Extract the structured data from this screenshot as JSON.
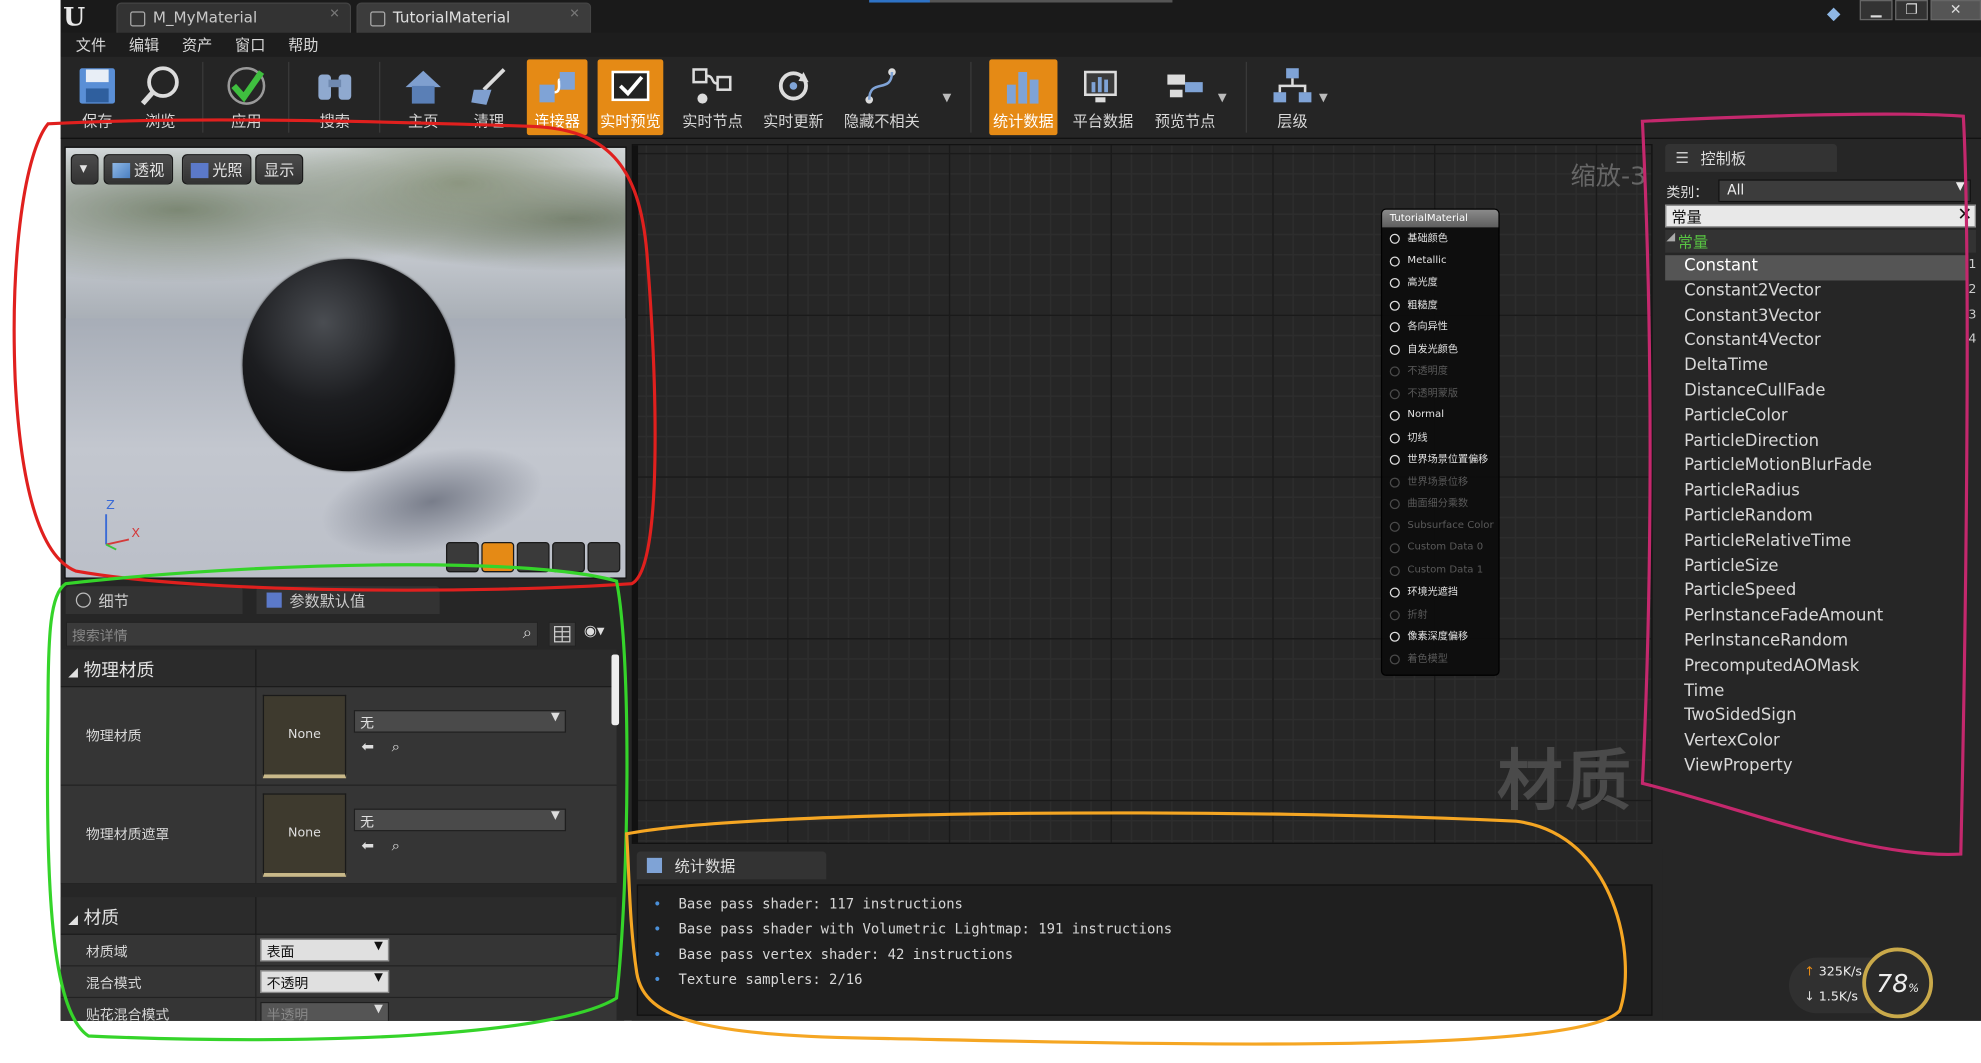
{
  "titlebar": {
    "tabs": [
      {
        "label": "M_MyMaterial"
      },
      {
        "label": "TutorialMaterial"
      }
    ]
  },
  "menu": [
    "文件",
    "编辑",
    "资产",
    "窗口",
    "帮助"
  ],
  "toolbar": {
    "buttons": [
      {
        "label": "保存",
        "icon": "save-icon"
      },
      {
        "label": "浏览",
        "icon": "browse-icon"
      },
      {
        "label": "应用",
        "icon": "apply-check-icon"
      },
      {
        "label": "搜索",
        "icon": "search-binoculars-icon"
      },
      {
        "label": "主页",
        "icon": "home-icon"
      },
      {
        "label": "清理",
        "icon": "clean-icon"
      },
      {
        "label": "连接器",
        "icon": "connectors-icon",
        "active": true
      },
      {
        "label": "实时预览",
        "icon": "live-preview-icon",
        "active": true
      },
      {
        "label": "实时节点",
        "icon": "live-nodes-icon"
      },
      {
        "label": "实时更新",
        "icon": "live-update-icon"
      },
      {
        "label": "隐藏不相关",
        "icon": "hide-unrelated-icon"
      },
      {
        "label": "统计数据",
        "icon": "stats-icon",
        "active": true
      },
      {
        "label": "平台数据",
        "icon": "platform-stats-icon"
      },
      {
        "label": "预览节点",
        "icon": "preview-node-icon"
      },
      {
        "label": "层级",
        "icon": "hierarchy-icon"
      }
    ]
  },
  "viewport": {
    "buttons": {
      "perspective": "透视",
      "lit": "光照",
      "show": "显示"
    },
    "axis": {
      "z": "Z",
      "x": "X"
    }
  },
  "details": {
    "tabs": {
      "details": "细节",
      "params": "参数默认值"
    },
    "search_placeholder": "搜索详情",
    "sections": {
      "phys": "物理材质",
      "material": "材质"
    },
    "phys_rows": [
      {
        "name": "物理材质",
        "thumb": "None",
        "value": "无"
      },
      {
        "name": "物理材质遮罩",
        "thumb": "None",
        "value": "无"
      }
    ],
    "material_rows": [
      {
        "name": "材质域",
        "value": "表面"
      },
      {
        "name": "混合模式",
        "value": "不透明"
      },
      {
        "name": "贴花混合模式",
        "value": "半透明"
      }
    ]
  },
  "graph": {
    "zoom": "缩放-3",
    "watermark": "材质",
    "node": {
      "title": "TutorialMaterial",
      "pins": [
        {
          "label": "基础颜色",
          "enabled": true
        },
        {
          "label": "Metallic",
          "enabled": true
        },
        {
          "label": "高光度",
          "enabled": true
        },
        {
          "label": "粗糙度",
          "enabled": true
        },
        {
          "label": "各向异性",
          "enabled": true
        },
        {
          "label": "自发光颜色",
          "enabled": true
        },
        {
          "label": "不透明度",
          "enabled": false
        },
        {
          "label": "不透明蒙版",
          "enabled": false
        },
        {
          "label": "Normal",
          "enabled": true
        },
        {
          "label": "切线",
          "enabled": true
        },
        {
          "label": "世界场景位置偏移",
          "enabled": true
        },
        {
          "label": "世界场景位移",
          "enabled": false
        },
        {
          "label": "曲面细分乘数",
          "enabled": false
        },
        {
          "label": "Subsurface Color",
          "enabled": false
        },
        {
          "label": "Custom Data 0",
          "enabled": false
        },
        {
          "label": "Custom Data 1",
          "enabled": false
        },
        {
          "label": "环境光遮挡",
          "enabled": true
        },
        {
          "label": "折射",
          "enabled": false
        },
        {
          "label": "像素深度偏移",
          "enabled": true
        },
        {
          "label": "着色模型",
          "enabled": false
        }
      ]
    }
  },
  "stats": {
    "tab": "统计数据",
    "lines": [
      "Base pass shader: 117 instructions",
      "Base pass shader with Volumetric Lightmap: 191 instructions",
      "Base pass vertex shader: 42 instructions",
      "Texture samplers: 2/16"
    ]
  },
  "palette": {
    "tab": "控制板",
    "category_label": "类别：",
    "category_value": "All",
    "search_value": "常量",
    "group": "常量",
    "items": [
      {
        "label": "Constant",
        "hotkey": "1",
        "selected": true
      },
      {
        "label": "Constant2Vector",
        "hotkey": "2"
      },
      {
        "label": "Constant3Vector",
        "hotkey": "3"
      },
      {
        "label": "Constant4Vector",
        "hotkey": "4"
      },
      {
        "label": "DeltaTime"
      },
      {
        "label": "DistanceCullFade"
      },
      {
        "label": "ParticleColor"
      },
      {
        "label": "ParticleDirection"
      },
      {
        "label": "ParticleMotionBlurFade"
      },
      {
        "label": "ParticleRadius"
      },
      {
        "label": "ParticleRandom"
      },
      {
        "label": "ParticleRelativeTime"
      },
      {
        "label": "ParticleSize"
      },
      {
        "label": "ParticleSpeed"
      },
      {
        "label": "PerInstanceFadeAmount"
      },
      {
        "label": "PerInstanceRandom"
      },
      {
        "label": "PrecomputedAOMask"
      },
      {
        "label": "Time"
      },
      {
        "label": "TwoSidedSign"
      },
      {
        "label": "VertexColor"
      },
      {
        "label": "ViewProperty"
      }
    ]
  },
  "netmonitor": {
    "up": "325K/s",
    "down": "1.5K/s",
    "percent": "78",
    "percent_sign": "%"
  },
  "colors": {
    "accent_orange": "#e58a15",
    "annotation_red": "#e0201e",
    "annotation_green": "#35d42a",
    "annotation_orange": "#f5a623",
    "annotation_magenta": "#c4286d",
    "palette_group_green": "#58c443"
  }
}
